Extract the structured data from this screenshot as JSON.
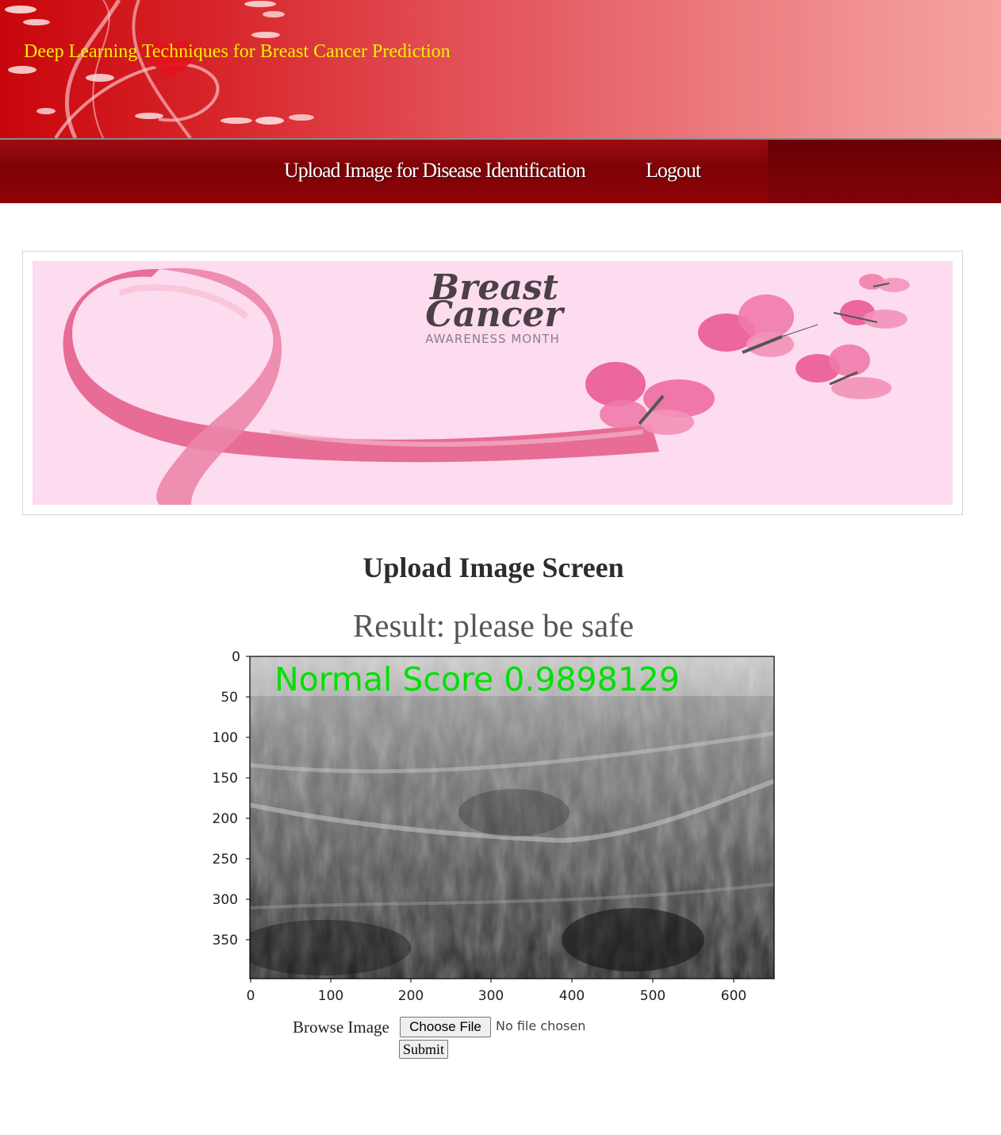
{
  "header": {
    "title": "Deep Learning Techniques for Breast Cancer Prediction"
  },
  "nav": {
    "items": [
      {
        "label": "Upload Image for Disease Identification"
      },
      {
        "label": "Logout"
      }
    ]
  },
  "banner": {
    "title_line1": "Breast",
    "title_line2": "Cancer",
    "subtitle": "AWARENESS MONTH"
  },
  "main": {
    "heading": "Upload Image Screen",
    "result": "Result: please be safe"
  },
  "result_image": {
    "overlay_text": "Normal Score 0.9898129",
    "overlay_color": "#00e000",
    "x_ticks": [
      "0",
      "100",
      "200",
      "300",
      "400",
      "500",
      "600"
    ],
    "y_ticks": [
      "0",
      "50",
      "100",
      "150",
      "200",
      "250",
      "300",
      "350"
    ]
  },
  "form": {
    "browse_label": "Browse Image",
    "choose_file_label": "Choose File",
    "no_file_text": "No file chosen",
    "submit_label": "Submit"
  },
  "colors": {
    "header_red": "#c8060b",
    "nav_dark_red": "#7e0206",
    "title_yellow": "#f2f200",
    "banner_pink": "#fcdcee",
    "ribbon_pink": "#e0457a"
  }
}
